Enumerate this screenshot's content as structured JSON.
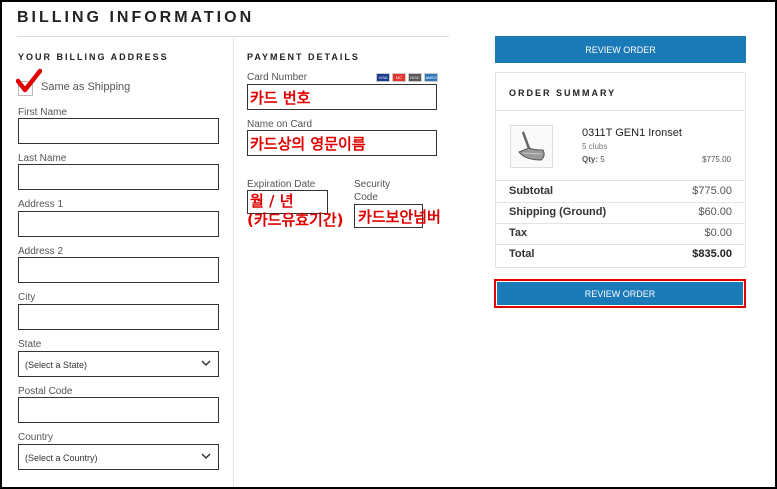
{
  "page": {
    "title": "BILLING INFORMATION"
  },
  "billing": {
    "heading": "YOUR BILLING ADDRESS",
    "same_as_shipping_label": "Same as Shipping",
    "same_as_shipping_checked": true,
    "first_name_label": "First Name",
    "last_name_label": "Last Name",
    "address1_label": "Address 1",
    "address2_label": "Address 2",
    "city_label": "City",
    "state_label": "State",
    "state_value": "(Select a State)",
    "postal_label": "Postal Code",
    "country_label": "Country",
    "country_value": "(Select a Country)"
  },
  "payment": {
    "heading": "PAYMENT DETAILS",
    "card_number_label": "Card Number",
    "card_number_annotation": "카드 번호",
    "name_on_card_label": "Name on Card",
    "name_on_card_annotation": "카드상의 영문이름",
    "expiration_label": "Expiration Date",
    "expiration_annotation_line1": "월 / 년",
    "expiration_annotation_line2": "(카드유효기간)",
    "security_label_line1": "Security",
    "security_label_line2": "Code",
    "security_annotation": "카드보안넘버",
    "card_brands": [
      {
        "name": "VISA",
        "color": "#1a3a8f"
      },
      {
        "name": "MC",
        "color": "#e3342f"
      },
      {
        "name": "DISC",
        "color": "#555555"
      },
      {
        "name": "AMEX",
        "color": "#2e77bb"
      }
    ]
  },
  "actions": {
    "review_order_top": "REVIEW ORDER",
    "review_order_bottom": "REVIEW ORDER",
    "accent_color": "#1a7ab8",
    "highlight_color": "#e00000"
  },
  "summary": {
    "heading": "ORDER SUMMARY",
    "product": {
      "name": "0311T GEN1 Ironset",
      "sub": "5 clubs",
      "qty_label": "Qty:",
      "qty_value": "5",
      "price": "$775.00",
      "image_icon": "golf-iron-icon"
    },
    "subtotal_label": "Subtotal",
    "subtotal_value": "$775.00",
    "shipping_label": "Shipping (Ground)",
    "shipping_value": "$60.00",
    "tax_label": "Tax",
    "tax_value": "$0.00",
    "total_label": "Total",
    "total_value": "$835.00"
  }
}
